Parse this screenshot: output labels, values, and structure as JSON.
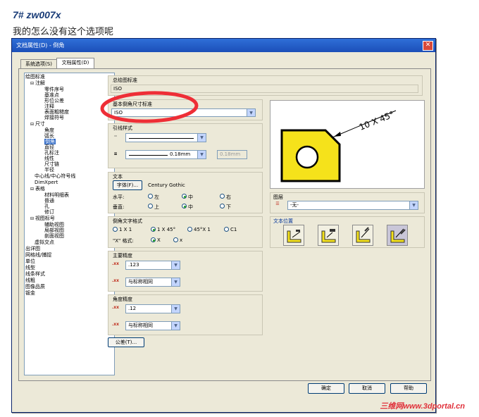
{
  "post": {
    "number": "7#",
    "author": "zw007x",
    "body": "我的怎么没有这个选项呢"
  },
  "dialog": {
    "title": "文档属性(D) - 倒角",
    "close_glyph": "✕",
    "tabs": [
      {
        "label": "系统选项(S)"
      },
      {
        "label": "文档属性(D)"
      }
    ],
    "tree": [
      "绘图标准",
      "注解",
      "零件序号",
      "基准点",
      "形位公差",
      "注释",
      "表面粗糙度",
      "焊接符号",
      "尺寸",
      "角度",
      "弧长",
      "倒角",
      "直径",
      "孔标注",
      "线性",
      "尺寸链",
      "半径",
      "中心线/中心符号线",
      "DimXpert",
      "表格",
      "材料明细表",
      "普通",
      "孔",
      "修订",
      "视图标号",
      "辅助视图",
      "局部视图",
      "剖面视图",
      "虚拟交点",
      "出详图",
      "网格线/捕捉",
      "单位",
      "线型",
      "线条样式",
      "线粗",
      "图像品质",
      "钣金"
    ],
    "overall_std": {
      "title": "总绘图标准",
      "value": "ISO"
    },
    "base_std": {
      "title": "基本倒角尺寸标准",
      "value": "ISO"
    },
    "leader": {
      "title": "引线样式",
      "width_value": "0.18mm",
      "custom_value": "0.18mm"
    },
    "text": {
      "title": "文本",
      "font_button": "字体(F)...",
      "font_name": "Century Gothic",
      "horizontal_label": "水平:",
      "vertical_label": "垂直:",
      "h_options": [
        "左",
        "中",
        "右"
      ],
      "v_options": [
        "上",
        "中",
        "下"
      ]
    },
    "chamfer_fmt": {
      "title": "倒角文字格式",
      "options": [
        "1 X 1",
        "1 X 45°",
        "45°X 1",
        "C1"
      ],
      "x_label": "\"X\" 格式:",
      "x_options": [
        "X",
        "x"
      ]
    },
    "primary_precision": {
      "title": "主要精度",
      "value1": ".123",
      "value2": "与标称相同"
    },
    "angle_precision": {
      "title": "角度精度",
      "value1": ".12",
      "value2": "与标称相同"
    },
    "tolerance_button": "公差(T)...",
    "preview": {
      "dimension_text": "10 X 45°"
    },
    "layer": {
      "title": "图层",
      "value": "-无-"
    },
    "text_position": {
      "title": "文本位置"
    },
    "buttons": {
      "ok": "确定",
      "cancel": "取消",
      "help": "帮助"
    }
  },
  "watermark": "三维网www.3dportal.cn",
  "colors": {
    "titlebar": "#1c4fb8",
    "preview_shape": "#f5e21b",
    "annotation": "#ee2e36"
  }
}
